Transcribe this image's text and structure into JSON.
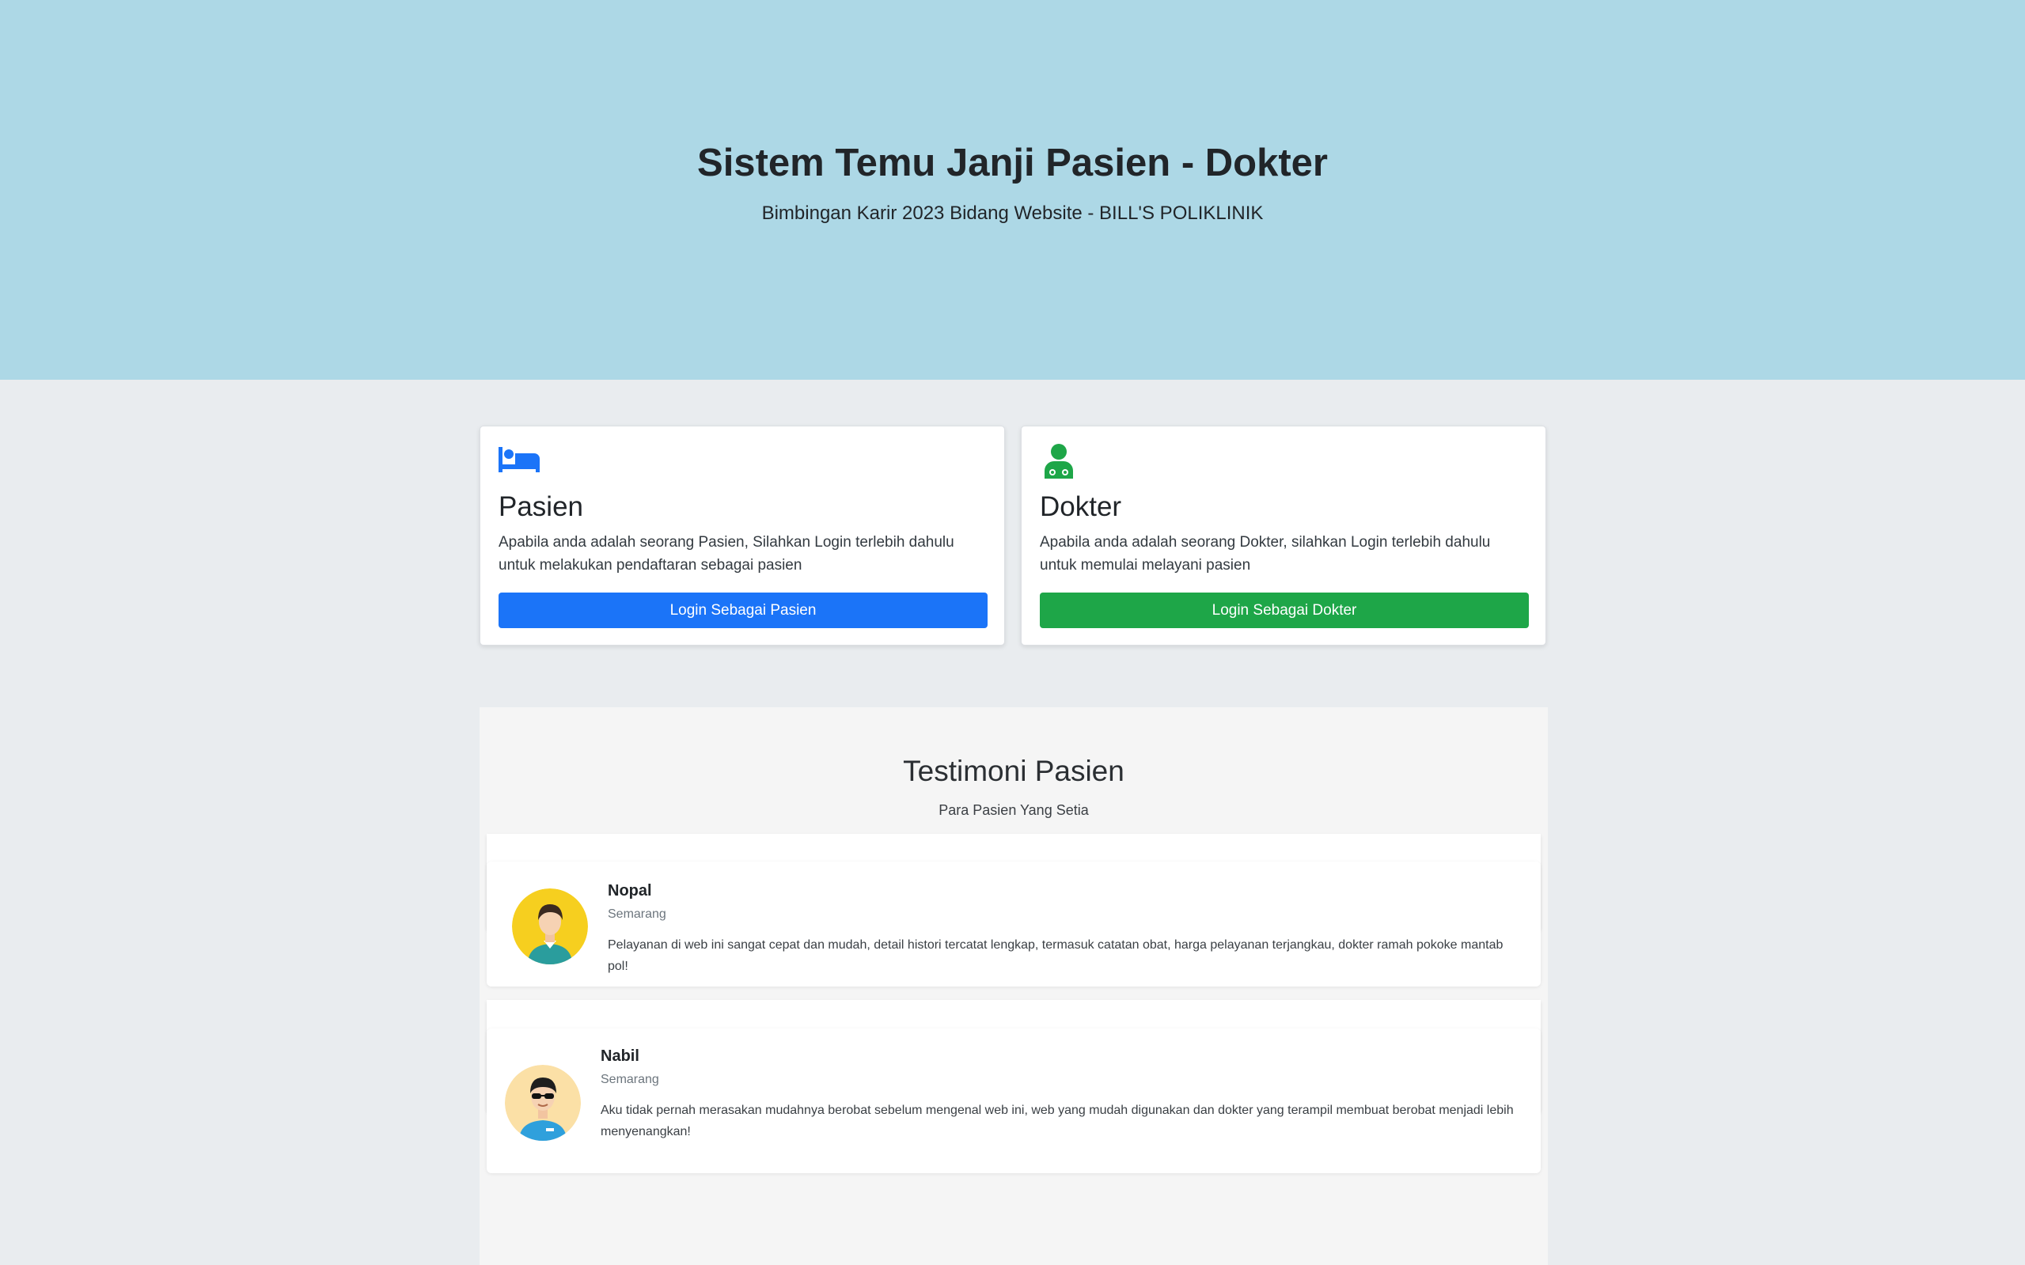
{
  "hero": {
    "title": "Sistem Temu Janji Pasien - Dokter",
    "subtitle": "Bimbingan Karir 2023 Bidang Website - BILL'S POLIKLINIK"
  },
  "roles": [
    {
      "icon": "bed-icon",
      "title": "Pasien",
      "description": "Apabila anda adalah seorang Pasien, Silahkan Login terlebih dahulu untuk melakukan pendaftaran sebagai pasien",
      "button": "Login Sebagai Pasien",
      "color": "#1b74f8"
    },
    {
      "icon": "doctor-icon",
      "title": "Dokter",
      "description": "Apabila anda adalah seorang Dokter, silahkan Login terlebih dahulu untuk memulai melayani pasien",
      "button": "Login Sebagai Dokter",
      "color": "#1ea648"
    }
  ],
  "testimonials": {
    "title": "Testimoni Pasien",
    "subtitle": "Para Pasien Yang Setia",
    "items": [
      {
        "name": "Nopal",
        "city": "Semarang",
        "text": "Pelayanan di web ini sangat cepat dan mudah, detail histori tercatat lengkap, termasuk catatan obat, harga pelayanan terjangkau, dokter ramah pokoke mantab pol!",
        "avatar": "man-avatar-icon"
      },
      {
        "name": "Nabil",
        "city": "Semarang",
        "text": "Aku tidak pernah merasakan mudahnya berobat sebelum mengenal web ini, web yang mudah digunakan dan dokter yang terampil membuat berobat menjadi lebih menyenangkan!",
        "avatar": "sunglasses-man-avatar-icon"
      }
    ]
  },
  "colors": {
    "hero_bg": "#add8e6",
    "page_bg": "#e9ecef",
    "primary": "#1b74f8",
    "success": "#1ea648"
  }
}
